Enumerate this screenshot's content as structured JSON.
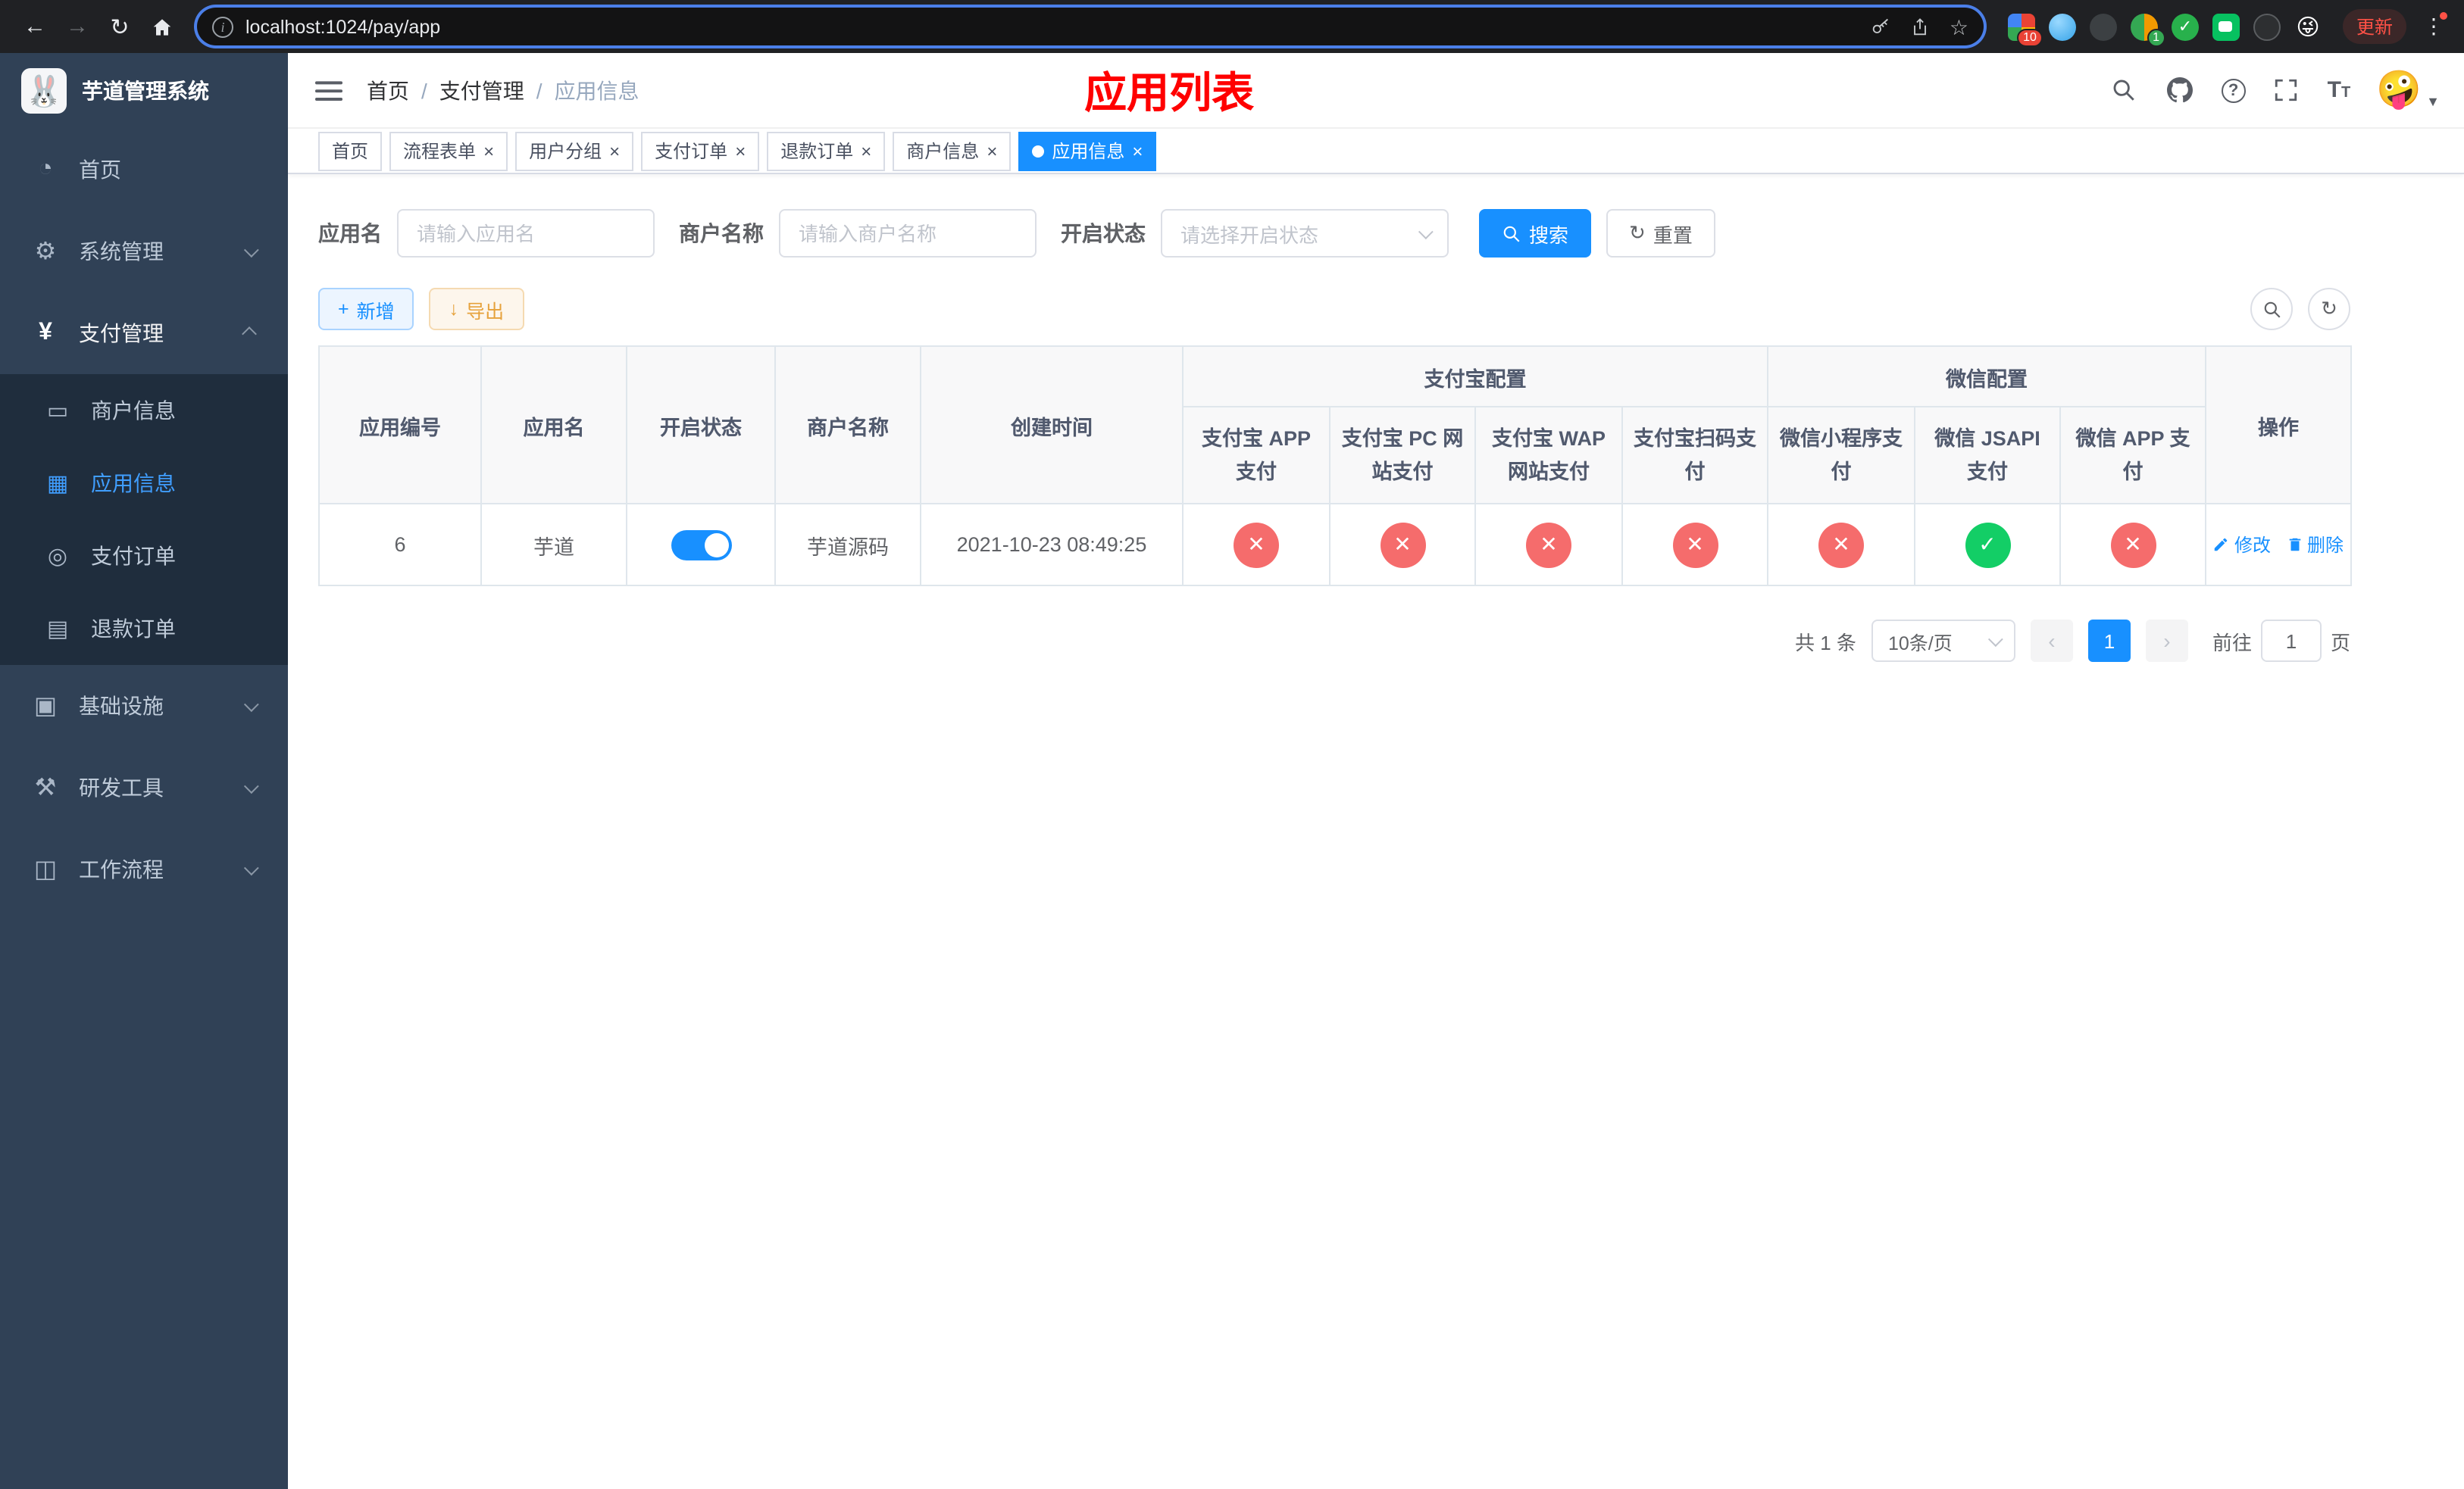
{
  "browser": {
    "url": "localhost:1024/pay/app",
    "update_label": "更新",
    "ext_badge_grid": "10",
    "ext_badge_avatar": "1"
  },
  "sidebar": {
    "title": "芋道管理系统",
    "items": [
      {
        "label": "首页"
      },
      {
        "label": "系统管理"
      },
      {
        "label": "支付管理"
      },
      {
        "label": "基础设施"
      },
      {
        "label": "研发工具"
      },
      {
        "label": "工作流程"
      }
    ],
    "sub_items": [
      {
        "label": "商户信息"
      },
      {
        "label": "应用信息"
      },
      {
        "label": "支付订单"
      },
      {
        "label": "退款订单"
      }
    ]
  },
  "header": {
    "breadcrumb": [
      {
        "label": "首页"
      },
      {
        "label": "支付管理"
      },
      {
        "label": "应用信息"
      }
    ],
    "separator": "/",
    "page_title": "应用列表"
  },
  "tabs": [
    {
      "label": "首页"
    },
    {
      "label": "流程表单"
    },
    {
      "label": "用户分组"
    },
    {
      "label": "支付订单"
    },
    {
      "label": "退款订单"
    },
    {
      "label": "商户信息"
    },
    {
      "label": "应用信息"
    }
  ],
  "filters": {
    "app_name_label": "应用名",
    "app_name_placeholder": "请输入应用名",
    "merchant_label": "商户名称",
    "merchant_placeholder": "请输入商户名称",
    "status_label": "开启状态",
    "status_placeholder": "请选择开启状态",
    "search_label": "搜索",
    "reset_label": "重置"
  },
  "toolbar": {
    "add_label": "新增",
    "export_label": "导出"
  },
  "table": {
    "group_headers": {
      "alipay": "支付宝配置",
      "wechat": "微信配置"
    },
    "headers": {
      "app_id": "应用编号",
      "app_name": "应用名",
      "status": "开启状态",
      "merchant": "商户名称",
      "created": "创建时间",
      "alipay_app": "支付宝 APP 支付",
      "alipay_pc": "支付宝 PC 网站支付",
      "alipay_wap": "支付宝 WAP 网站支付",
      "alipay_qr": "支付宝扫码支付",
      "wx_mini": "微信小程序支付",
      "wx_jsapi": "微信 JSAPI 支付",
      "wx_app": "微信 APP 支付",
      "ops": "操作"
    },
    "row": {
      "app_id": "6",
      "app_name": "芋道",
      "status_on": true,
      "merchant": "芋道源码",
      "created": "2021-10-23 08:49:25",
      "pay_channels": {
        "alipay_app": false,
        "alipay_pc": false,
        "alipay_wap": false,
        "alipay_qr": false,
        "wx_mini": false,
        "wx_jsapi": true,
        "wx_app": false
      },
      "edit_label": "修改",
      "delete_label": "删除"
    }
  },
  "pagination": {
    "total_text": "共 1 条",
    "page_size_text": "10条/页",
    "current_page": "1",
    "goto_label": "前往",
    "goto_value": "1",
    "goto_page_suffix": "页"
  }
}
